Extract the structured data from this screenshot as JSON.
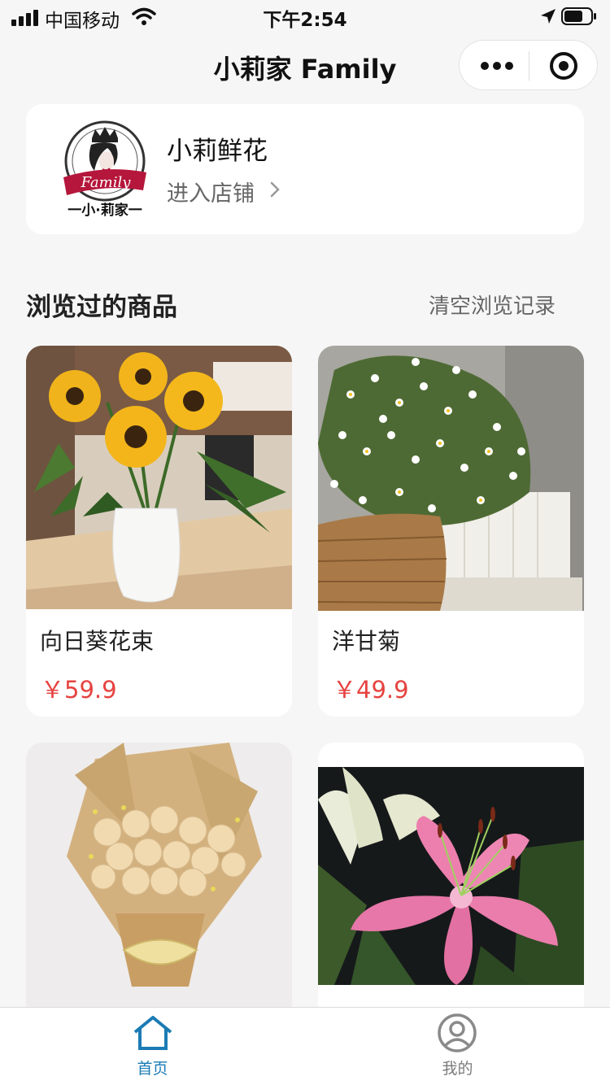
{
  "status_bar": {
    "carrier": "中国移动",
    "time": "下午2:54"
  },
  "nav": {
    "title": "小莉家 Family",
    "capsule_more_icon": "more-dots-icon",
    "capsule_close_icon": "circle-close-icon"
  },
  "store": {
    "logo": {
      "badge_text": "Family",
      "caption": "一小·莉家一"
    },
    "name": "小莉鲜花",
    "enter_label": "进入店铺",
    "enter_icon": "chevron-right-icon"
  },
  "section": {
    "title": "浏览过的商品",
    "clear_label": "清空浏览记录"
  },
  "products": [
    {
      "name": "向日葵花束",
      "price": "￥59.9",
      "image": "sunflower-vase-photo"
    },
    {
      "name": "洋甘菊",
      "price": "￥49.9",
      "image": "chamomile-basket-photo"
    },
    {
      "name": "",
      "price": "",
      "image": "champagne-rose-bouquet-photo"
    },
    {
      "name": "",
      "price": "",
      "image": "pink-lily-photo"
    }
  ],
  "tabbar": {
    "tabs": [
      {
        "label": "首页",
        "icon": "home-icon",
        "active": true
      },
      {
        "label": "我的",
        "icon": "user-icon",
        "active": false
      }
    ],
    "active_color": "#1b7bb4",
    "inactive_color": "#7b7b7b"
  },
  "colors": {
    "price": "#e64340",
    "background": "#f6f6f6",
    "logo_ribbon": "#b5163b"
  }
}
